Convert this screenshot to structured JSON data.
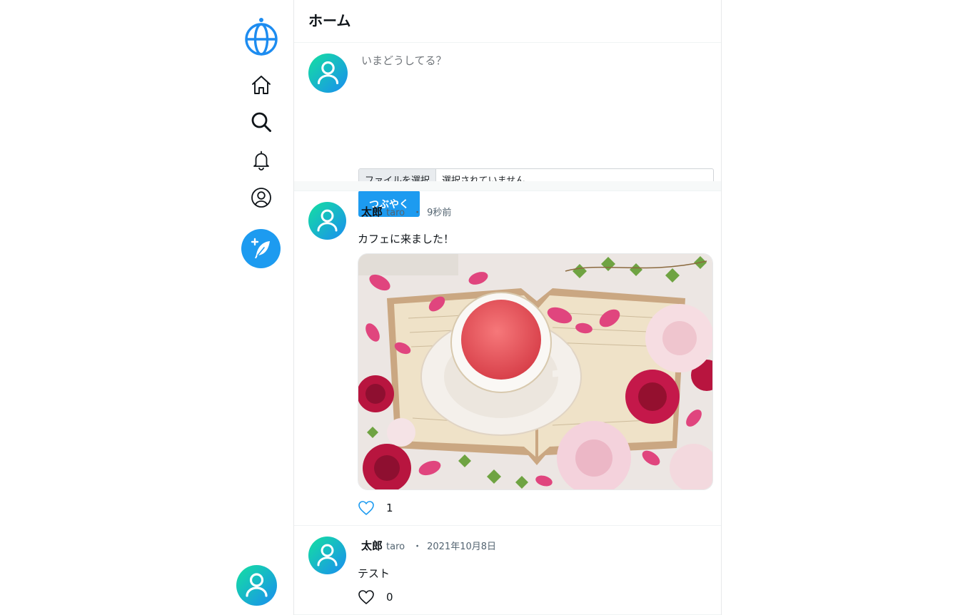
{
  "sidebar": {
    "logo": "globe-logo",
    "nav": [
      {
        "icon": "home-icon"
      },
      {
        "icon": "search-icon"
      },
      {
        "icon": "bell-icon"
      },
      {
        "icon": "profile-icon"
      }
    ],
    "compose_icon": "feather-plus-icon"
  },
  "header": {
    "title": "ホーム"
  },
  "composer": {
    "placeholder": "いまどうしてる？",
    "file_button": "ファイルを選択",
    "file_status": "選択されていません",
    "submit_label": "つぶやく"
  },
  "posts": [
    {
      "name": "太郎",
      "handle": "taro",
      "separator": "・",
      "time": "9秒前",
      "text": "カフェに来ました！",
      "has_image": true,
      "likes": "1",
      "liked": true
    },
    {
      "name": "太郎",
      "handle": "taro",
      "separator": "・",
      "time": "2021年10月8日",
      "text": "テスト",
      "has_image": false,
      "likes": "0",
      "liked": false
    }
  ],
  "colors": {
    "accent": "#1d9bf0",
    "avatar_gradient_start": "#0bd6a0",
    "avatar_gradient_end": "#1d8cf0"
  }
}
